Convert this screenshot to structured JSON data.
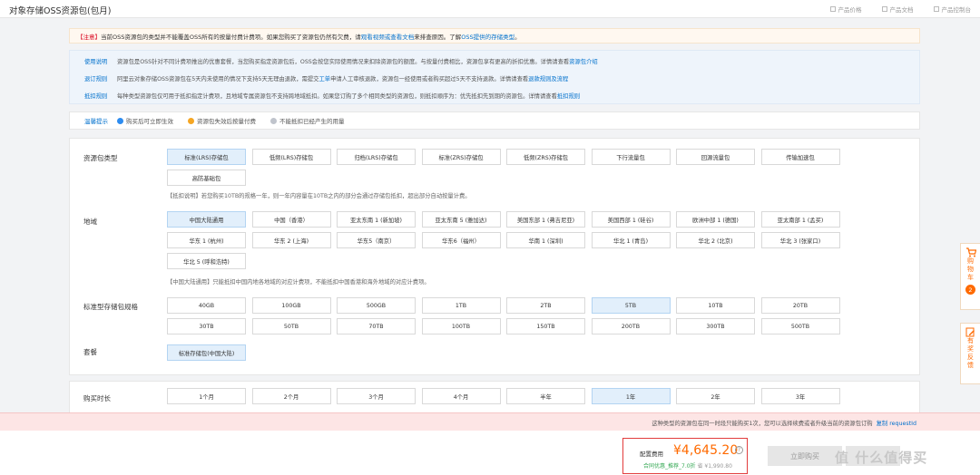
{
  "header": {
    "title": "对象存储OSS资源包(包月)",
    "links": [
      "产品价格",
      "产品文档",
      "产品控制台"
    ]
  },
  "notice": {
    "tag": "【注意】",
    "text": "当前OSS资源包的类型并不能覆盖OSS所有的按量付费计费项。如果您购买了资源包仍然有欠费，请",
    "link1": "观看视频或查看文档",
    "text2": "来排查原因。了解",
    "link2": "OSS提供的存储类型",
    "text3": "。"
  },
  "info_rows": [
    {
      "label": "使用说明",
      "text": "资源包是OSS针对不同计费项推出的优惠套餐，当您购买指定资源包后，OSS会按您实际使用情况来扣除资源包的额度。与按量付费相比，资源包享有更高的折扣优惠。详情请查看",
      "link": "资源包介绍"
    },
    {
      "label": "退订规则",
      "text": "阿里云对象存储OSS资源包在5天内未使用的情况下支持5天无理由退款，需提交",
      "link_mid": "工单",
      "text2": "申请人工审核退款，资源包一经使用或者购买超过5天不支持退款。详情请查看",
      "link": "退款规则及流程"
    },
    {
      "label": "抵扣规则",
      "text": "每种类型资源包仅可用于抵扣指定计费项，且地域专属资源包不支持跨地域抵扣。如果您订购了多个相同类型的资源包，则抵扣顺序为：优先抵扣先到期的资源包。详情请查看",
      "link": "抵扣规则"
    }
  ],
  "tips": {
    "label": "温馨提示",
    "items": [
      "购买后可立即生效",
      "资源包失效后按量付费",
      "不能抵扣已经产生的用量"
    ]
  },
  "config": {
    "package_type": {
      "label": "资源包类型",
      "options": [
        "标准(LRS)存储包",
        "低频(LRS)存储包",
        "归档(LRS)存储包",
        "标准(ZRS)存储包",
        "低频(ZRS)存储包",
        "下行流量包",
        "回源流量包",
        "传输加速包",
        "高防基础包"
      ],
      "selected": 0,
      "note": "【抵扣说明】若您购买10TB的规格一年，则一年内容量在10TB之内的部分会通过存储包抵扣，超出部分自动按量计费。"
    },
    "region": {
      "label": "地域",
      "options": [
        "中国大陆通用",
        "中国（香港）",
        "亚太东南 1 (新加坡)",
        "亚太东南 5 (雅加达)",
        "美国东部 1 (弗吉尼亚)",
        "美国西部 1 (硅谷)",
        "欧洲中部 1 (德国)",
        "亚太南部 1 (孟买)",
        "华东 1 (杭州)",
        "华东 2 (上海)",
        "华东5（南京）",
        "华东6（福州）",
        "华南 1 (深圳)",
        "华北 1 (青岛)",
        "华北 2 (北京)",
        "华北 3 (张家口)",
        "华北 5 (呼和浩特)"
      ],
      "selected": 0,
      "note": "【中国大陆通用】只能抵扣中国内地各地域的对应计费项，不能抵扣中国香港和海外地域的对应计费项。"
    },
    "size": {
      "label": "标准型存储包规格",
      "options": [
        "40GB",
        "100GB",
        "500GB",
        "1TB",
        "2TB",
        "5TB",
        "10TB",
        "20TB",
        "30TB",
        "50TB",
        "70TB",
        "100TB",
        "150TB",
        "200TB",
        "300TB",
        "500TB"
      ],
      "selected": 5
    },
    "plan": {
      "label": "套餐",
      "options": [
        "标准存储包(中国大陆)"
      ],
      "selected": 0
    },
    "duration": {
      "label": "购买时长",
      "options": [
        "1个月",
        "2个月",
        "3个月",
        "4个月",
        "半年",
        "1年",
        "2年",
        "3年"
      ],
      "selected": 5
    }
  },
  "warning": {
    "text": "这种类型的资源包在同一时段只能购买1次，您可以选择续费或者升级当前的资源包订购",
    "link": "复制 requestId"
  },
  "summary": {
    "price_label": "配置费用",
    "price": "¥4,645.20",
    "help": "?",
    "discount": "合同优惠_推荐_7.0折",
    "saved": "省 ¥1,990.80",
    "buy_label": "立即购买"
  },
  "side_tabs": {
    "cart_label": "购物车",
    "cart_count": "2",
    "feedback_label": "有奖反馈"
  },
  "watermark": "值 什么值得买",
  "colors": {
    "accent": "#ff6a00",
    "link": "#0070cc",
    "selected_bg": "#e2effb",
    "warning_bg": "#fde5e5"
  }
}
